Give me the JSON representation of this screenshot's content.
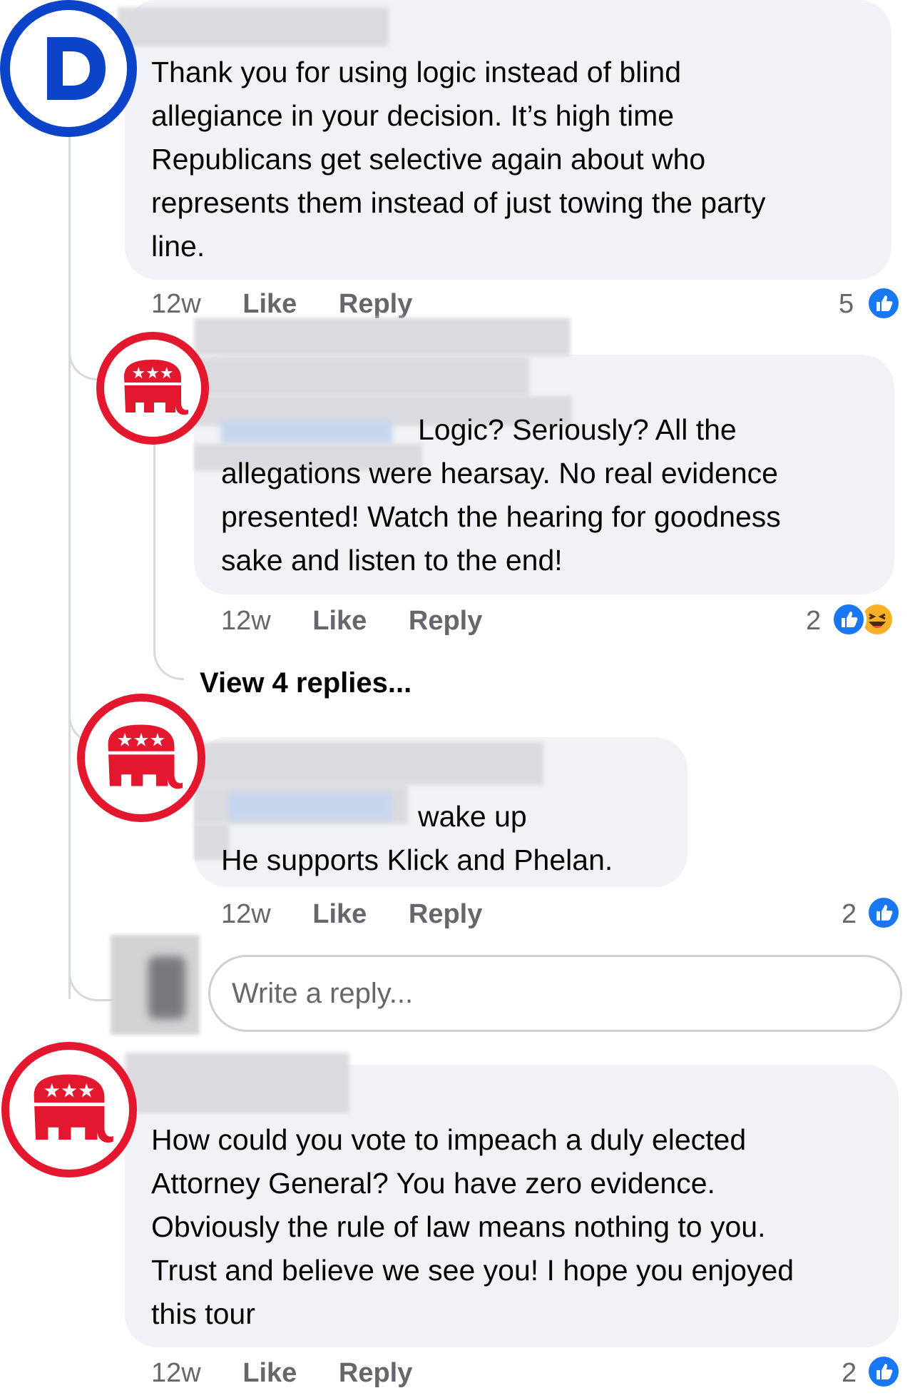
{
  "comments": [
    {
      "text": "Thank you for using logic instead of blind\nallegiance in your decision. It’s high time\nRepublicans get selective again about who\nrepresents them instead of just towing the party\nline.",
      "time": "12w",
      "like_label": "Like",
      "reply_label": "Reply",
      "reaction_count": "5",
      "avatar_letter": "D",
      "avatar_color": "#0b44c9"
    },
    {
      "text": "Logic? Seriously? All the\nallegations were hearsay.  No real evidence\npresented!  Watch the hearing for goodness\nsake and listen to the end!",
      "time": "12w",
      "like_label": "Like",
      "reply_label": "Reply",
      "reaction_count": "2",
      "avatar_color": "#e3172d"
    },
    {
      "text": "wake up\nHe supports Klick and Phelan.",
      "time": "12w",
      "like_label": "Like",
      "reply_label": "Reply",
      "reaction_count": "2",
      "avatar_color": "#e3172d"
    },
    {
      "text": "How could you vote to impeach a duly elected\nAttorney General? You have zero evidence.\nObviously the rule of law means nothing to you.\nTrust and believe we see you! I hope you enjoyed\nthis tour",
      "time": "12w",
      "like_label": "Like",
      "reply_label": "Reply",
      "reaction_count": "2",
      "avatar_color": "#e3172d"
    }
  ],
  "view_replies_label": "View 4 replies...",
  "reply_box": {
    "placeholder": "Write a reply..."
  },
  "colors": {
    "like_blue": "#1877f2",
    "bubble_bg": "#f0f2f5",
    "meta_gray": "#65676b"
  },
  "icons": {
    "like": "thumbs-up-icon",
    "haha": "laughing-face-icon",
    "democrat": "democrat-logo-icon",
    "republican": "republican-elephant-icon"
  }
}
